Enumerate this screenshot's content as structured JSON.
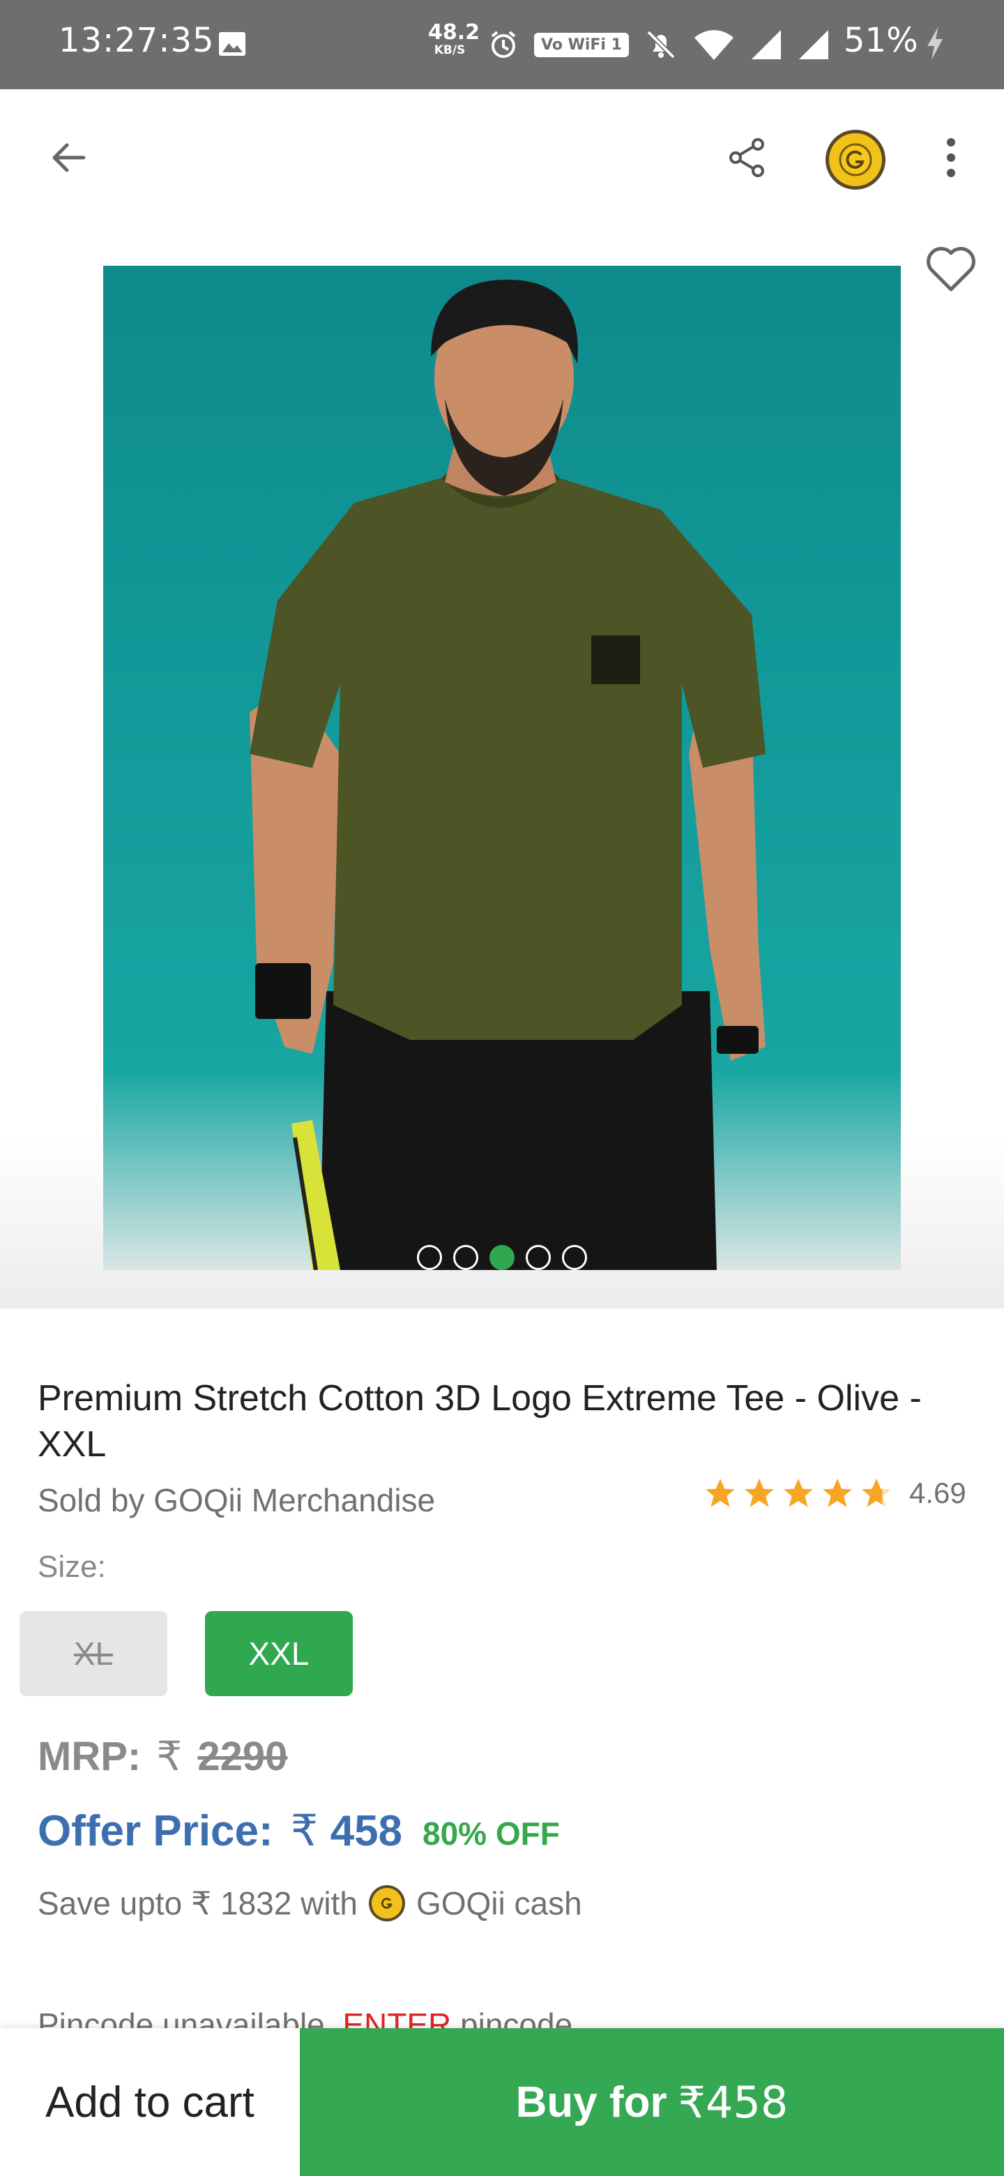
{
  "status_bar": {
    "time": "13:27:35",
    "net_speed_value": "48.2",
    "net_speed_unit": "KB/S",
    "wifi_label": "Vo WiFi 1",
    "battery": "51%"
  },
  "toolbar": {
    "back_icon": "arrow-left-icon",
    "share_icon": "share-icon",
    "coin_icon": "goqii-coin-icon",
    "menu_icon": "more-vertical-icon"
  },
  "gallery": {
    "image_description_icon": "product-photo",
    "dots_total": 5,
    "active_dot": 3
  },
  "product": {
    "title": "Premium Stretch Cotton 3D Logo Extreme Tee - Olive - XXL",
    "seller": "Sold by GOQii Merchandise",
    "rating": "4.69",
    "rating_stars_value": 4.69,
    "size_label": "Size:",
    "sizes": [
      {
        "label": "XL",
        "available": false,
        "selected": false
      },
      {
        "label": "XXL",
        "available": true,
        "selected": true
      }
    ],
    "mrp_label": "MRP:",
    "currency": "₹",
    "mrp_value": "2290",
    "offer_label": "Offer Price:",
    "offer_value": "458",
    "discount": "80% OFF",
    "save_prefix": "Save upto",
    "save_amount": "1832",
    "save_with": "with",
    "save_suffix": "GOQii cash",
    "pincode_text": "Pincode unavailable.",
    "pincode_enter": "ENTER",
    "pincode_tail": "pincode"
  },
  "actions": {
    "add_to_cart": "Add to cart",
    "buy_prefix": "Buy for",
    "buy_price": "₹458"
  },
  "colors": {
    "status_bar": "#6e6e6e",
    "green": "#34a853",
    "offer_blue": "#3d6fb0",
    "star": "#f6a623",
    "red": "#e02424"
  }
}
